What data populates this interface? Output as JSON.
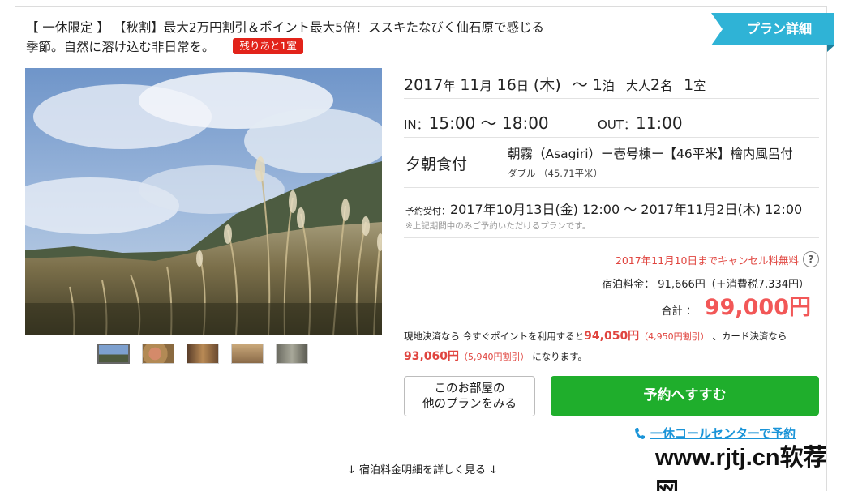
{
  "header": {
    "tag": "【 一休限定 】",
    "title": "【秋割】最大2万円割引＆ポイント最大5倍！ススキたなびく仙石原で感じる季節。自然に溶け込む非日常を。",
    "remaining_badge": "残りあと1室",
    "detail_button": "プラン詳細"
  },
  "stay": {
    "year": "2017",
    "year_unit": "年",
    "month": " 11",
    "month_unit": "月",
    "day": " 16",
    "day_unit": "日",
    "weekday": " (木)",
    "nights": "～ 1",
    "nights_unit": "泊",
    "guests_prefix": "大人",
    "guests": "2",
    "guests_unit": "名",
    "rooms": "1",
    "rooms_unit": "室",
    "checkin_label": "IN：",
    "checkin": "15:00 ～ 18:00",
    "checkout_label": "OUT：",
    "checkout": "11:00"
  },
  "room": {
    "meal": "夕朝食付",
    "name": "朝霧（Asagiri）ー壱号棟ー【46平米】檜内風呂付",
    "type": "ダブル （45.71平米）"
  },
  "booking": {
    "label": "予約受付：",
    "period": "2017年10月13日(金) 12:00 ～ 2017年11月2日(木) 12:00",
    "note": "※上記期間中のみご予約いただけるプランです。"
  },
  "price": {
    "cancel_note": "2017年11月10日までキャンセル料無料",
    "help_icon": "?",
    "room_charge_label": "宿泊料金：",
    "room_charge": "91,666円（＋消費税7,334円）",
    "total_label": "合計 ：",
    "total": "99,000円"
  },
  "points": {
    "text1": "現地決済なら 今すぐポイントを利用すると",
    "onsite_price": "94,050円",
    "onsite_discount": "（4,950円割引）",
    "text2": "、カード決済なら",
    "card_price": "93,060円",
    "card_discount": "（5,940円割引）",
    "text3": "になります。"
  },
  "actions": {
    "other_plans_line1": "このお部屋の",
    "other_plans_line2": "他のプランをみる",
    "reserve": "予約へすすむ",
    "call_center": "一休コールセンターで予約",
    "details": "↓ 宿泊料金明細を詳しく見る ↓"
  },
  "watermark": "www.rjtj.cn软荐网",
  "icons": {
    "phone": "phone-icon",
    "help": "help-icon"
  },
  "colors": {
    "accent_red": "#e2231a",
    "price_red": "#f25757",
    "reserve_green": "#1fae2c",
    "ribbon_blue": "#2fb3d6",
    "link_blue": "#1a94d8"
  }
}
